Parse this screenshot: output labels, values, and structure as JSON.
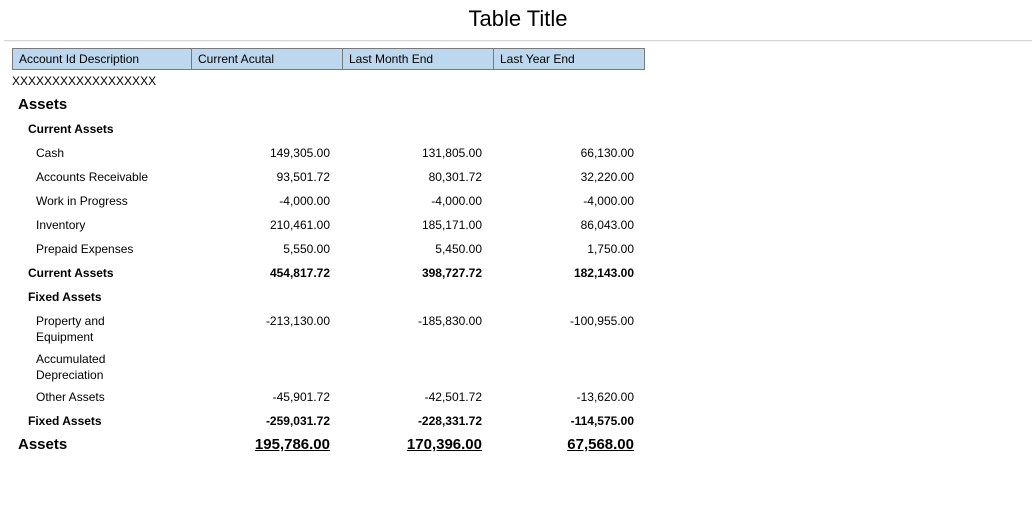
{
  "title": "Table Title",
  "headers": {
    "c1": "Account Id Description",
    "c2": "Current Acutal",
    "c3": "Last Month End",
    "c4": "Last Year End"
  },
  "placeholder_row": "XXXXXXXXXXXXXXXXXX",
  "section_title": "Assets",
  "groups": [
    {
      "title": "Current Assets",
      "rows": [
        {
          "label": "Cash",
          "c2": "149,305.00",
          "c3": "131,805.00",
          "c4": "66,130.00"
        },
        {
          "label": "Accounts Receivable",
          "c2": "93,501.72",
          "c3": "80,301.72",
          "c4": "32,220.00"
        },
        {
          "label": "Work in Progress",
          "c2": "-4,000.00",
          "c3": "-4,000.00",
          "c4": "-4,000.00"
        },
        {
          "label": "Inventory",
          "c2": "210,461.00",
          "c3": "185,171.00",
          "c4": "86,043.00"
        },
        {
          "label": "Prepaid Expenses",
          "c2": "5,550.00",
          "c3": "5,450.00",
          "c4": "1,750.00"
        }
      ],
      "subtotal": {
        "label": "Current Assets",
        "c2": "454,817.72",
        "c3": "398,727.72",
        "c4": "182,143.00"
      }
    },
    {
      "title": "Fixed Assets",
      "rows": [
        {
          "label": "Property and Equipment",
          "c2": "-213,130.00",
          "c3": "-185,830.00",
          "c4": "-100,955.00"
        },
        {
          "label": "Accumulated Depreciation",
          "c2": "",
          "c3": "",
          "c4": ""
        },
        {
          "label": "Other Assets",
          "c2": "-45,901.72",
          "c3": "-42,501.72",
          "c4": "-13,620.00"
        }
      ],
      "subtotal": {
        "label": "Fixed Assets",
        "c2": "-259,031.72",
        "c3": "-228,331.72",
        "c4": "-114,575.00"
      }
    }
  ],
  "grand_total": {
    "label": "Assets",
    "c2": "195,786.00",
    "c3": "170,396.00",
    "c4": "67,568.00"
  },
  "chart_data": {
    "type": "table",
    "title": "Table Title",
    "columns": [
      "Account Id Description",
      "Current Acutal",
      "Last Month End",
      "Last Year End"
    ],
    "rows": [
      [
        "Assets",
        null,
        null,
        null
      ],
      [
        "Current Assets",
        null,
        null,
        null
      ],
      [
        "Cash",
        149305.0,
        131805.0,
        66130.0
      ],
      [
        "Accounts Receivable",
        93501.72,
        80301.72,
        32220.0
      ],
      [
        "Work in Progress",
        -4000.0,
        -4000.0,
        -4000.0
      ],
      [
        "Inventory",
        210461.0,
        185171.0,
        86043.0
      ],
      [
        "Prepaid Expenses",
        5550.0,
        5450.0,
        1750.0
      ],
      [
        "Current Assets (subtotal)",
        454817.72,
        398727.72,
        182143.0
      ],
      [
        "Fixed Assets",
        null,
        null,
        null
      ],
      [
        "Property and Equipment",
        -213130.0,
        -185830.0,
        -100955.0
      ],
      [
        "Accumulated Depreciation",
        null,
        null,
        null
      ],
      [
        "Other Assets",
        -45901.72,
        -42501.72,
        -13620.0
      ],
      [
        "Fixed Assets (subtotal)",
        -259031.72,
        -228331.72,
        -114575.0
      ],
      [
        "Assets (total)",
        195786.0,
        170396.0,
        67568.0
      ]
    ]
  }
}
